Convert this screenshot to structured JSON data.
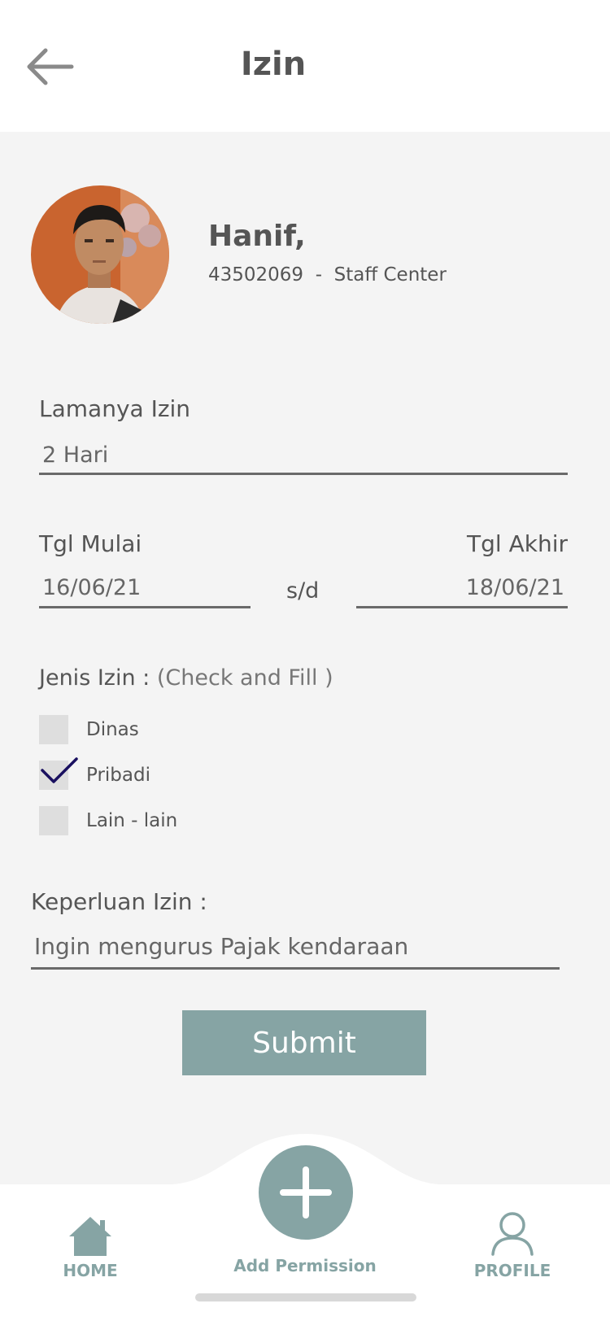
{
  "header": {
    "title": "Izin"
  },
  "user": {
    "name": "Hanif,",
    "id": "43502069",
    "separator": "  -  ",
    "role": "Staff Center"
  },
  "form": {
    "duration_label": "Lamanya Izin",
    "duration_value": "2 Hari",
    "start_label": "Tgl Mulai",
    "start_value": "16/06/21",
    "range_separator": "s/d",
    "end_label": "Tgl Akhir",
    "end_value": "18/06/21",
    "type_label": "Jenis Izin : ",
    "type_hint": "(Check and Fill )",
    "options": [
      {
        "label": "Dinas",
        "checked": false
      },
      {
        "label": "Pribadi",
        "checked": true
      },
      {
        "label": "Lain - lain",
        "checked": false
      }
    ],
    "purpose_label": "Keperluan Izin :",
    "purpose_value": "Ingin mengurus Pajak kendaraan",
    "submit_label": "Submit"
  },
  "bottom_nav": {
    "home_label": "HOME",
    "add_label": "Add Permission",
    "profile_label": "PROFILE"
  },
  "colors": {
    "accent": "#86a4a4",
    "check": "#1a1060",
    "background": "#f4f4f4"
  }
}
